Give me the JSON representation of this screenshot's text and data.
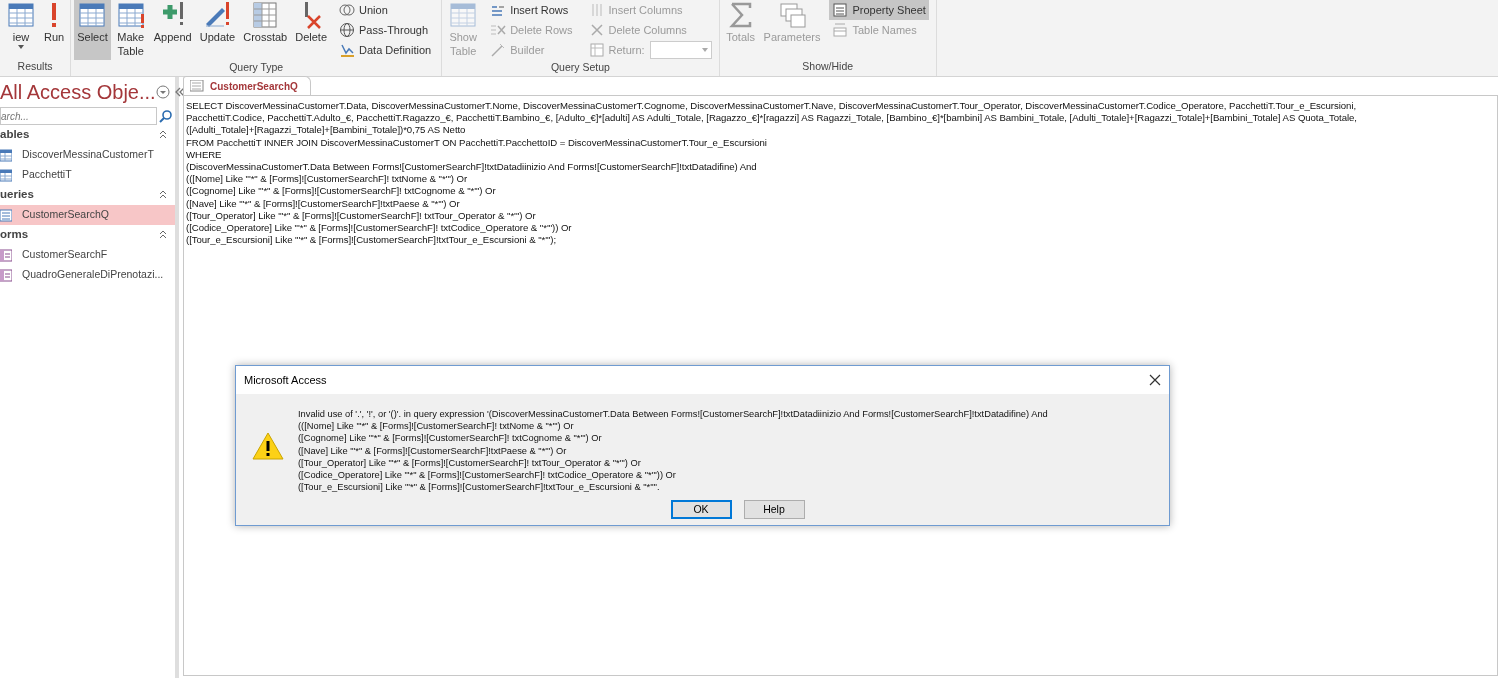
{
  "ribbon": {
    "groups": [
      {
        "label": "Results",
        "large": [
          {
            "label": "iew",
            "selected": false,
            "disabled": false,
            "dropdown": true
          },
          {
            "label": "Run",
            "selected": false,
            "disabled": false,
            "dropdown": false
          }
        ]
      },
      {
        "label": "Query Type",
        "large": [
          {
            "label": "Select",
            "selected": true,
            "disabled": false,
            "dropdown": false
          },
          {
            "label": "Make Table",
            "selected": false,
            "disabled": false,
            "dropdown": false
          },
          {
            "label": "Append",
            "selected": false,
            "disabled": false,
            "dropdown": false
          },
          {
            "label": "Update",
            "selected": false,
            "disabled": false,
            "dropdown": false
          },
          {
            "label": "Crosstab",
            "selected": false,
            "disabled": false,
            "dropdown": false
          },
          {
            "label": "Delete",
            "selected": false,
            "disabled": false,
            "dropdown": false
          }
        ],
        "small_columns": [
          [
            {
              "label": "Union",
              "kind": "button",
              "selected": false,
              "disabled": false
            },
            {
              "label": "Pass-Through",
              "kind": "button",
              "selected": false,
              "disabled": false
            },
            {
              "label": "Data Definition",
              "kind": "button",
              "selected": false,
              "disabled": false
            }
          ]
        ]
      },
      {
        "label": "Query Setup",
        "large": [
          {
            "label": "Show Table",
            "selected": false,
            "disabled": true,
            "dropdown": false
          }
        ],
        "small_columns": [
          [
            {
              "label": "Insert Rows",
              "kind": "button",
              "selected": false,
              "disabled": false
            },
            {
              "label": "Delete Rows",
              "kind": "button",
              "selected": false,
              "disabled": true
            },
            {
              "label": "Builder",
              "kind": "button",
              "selected": false,
              "disabled": true
            }
          ],
          [
            {
              "label": "Insert Columns",
              "kind": "button",
              "selected": false,
              "disabled": true
            },
            {
              "label": "Delete Columns",
              "kind": "button",
              "selected": false,
              "disabled": true
            },
            {
              "label": "Return:",
              "kind": "combo",
              "selected": false,
              "disabled": true
            }
          ]
        ]
      },
      {
        "label": "Show/Hide",
        "large": [
          {
            "label": "Totals",
            "selected": false,
            "disabled": true,
            "dropdown": false
          },
          {
            "label": "Parameters",
            "selected": false,
            "disabled": true,
            "dropdown": false
          }
        ],
        "small_columns": [
          [
            {
              "label": "Property Sheet",
              "kind": "button",
              "selected": true,
              "disabled": false
            },
            {
              "label": "Table Names",
              "kind": "button",
              "selected": false,
              "disabled": true
            }
          ]
        ]
      }
    ]
  },
  "nav": {
    "title": "All Access Obje...",
    "search": {
      "placeholder": "arch..."
    },
    "sections": [
      {
        "label": "ables",
        "kind": "table",
        "items": [
          {
            "label": "DiscoverMessinaCustomerT",
            "selected": false
          },
          {
            "label": "PacchettiT",
            "selected": false
          }
        ]
      },
      {
        "label": "ueries",
        "kind": "query",
        "items": [
          {
            "label": "CustomerSearchQ",
            "selected": true
          }
        ]
      },
      {
        "label": "orms",
        "kind": "form",
        "items": [
          {
            "label": "CustomerSearchF",
            "selected": false
          },
          {
            "label": "QuadroGeneraleDiPrenotazi...",
            "selected": false
          }
        ]
      }
    ]
  },
  "document": {
    "tab": "CustomerSearchQ",
    "sql_lines": [
      "SELECT DiscoverMessinaCustomerT.Data, DiscoverMessinaCustomerT.Nome, DiscoverMessinaCustomerT.Cognome, DiscoverMessinaCustomerT.Nave, DiscoverMessinaCustomerT.Tour_Operator, DiscoverMessinaCustomerT.Codice_Operatore, PacchettiT.Tour_e_Escursioni,",
      "PacchettiT.Codice, PacchettiT.Adulto_€, PacchettiT.Ragazzo_€, PacchettiT.Bambino_€, [Adulto_€]*[adulti] AS Adulti_Totale, [Ragazzo_€]*[ragazzi] AS Ragazzi_Totale, [Bambino_€]*[bambini] AS Bambini_Totale, [Adulti_Totale]+[Ragazzi_Totale]+[Bambini_Totale] AS Quota_Totale,",
      "([Adulti_Totale]+[Ragazzi_Totale]+[Bambini_Totale])*0,75 AS Netto",
      "FROM PacchettiT INNER JOIN DiscoverMessinaCustomerT ON PacchettiT.PacchettoID = DiscoverMessinaCustomerT.Tour_e_Escursioni",
      "WHERE",
      "(DiscoverMessinaCustomerT.Data Between Forms![CustomerSearchF]!txtDatadiinizio And Forms![CustomerSearchF]!txtDatadifine) And",
      "(([Nome] Like \"'*\" & [Forms]![CustomerSearchF]! txtNome & \"*'\") Or",
      "([Cognome] Like \"'*\" & [Forms]![CustomerSearchF]! txtCognome & \"*'\") Or",
      "([Nave] Like \"'*\" & [Forms]![CustomerSearchF]!txtPaese & \"*'\") Or",
      "([Tour_Operator] Like \"'*\" & [Forms]![CustomerSearchF]! txtTour_Operator & \"*'\") Or",
      "([Codice_Operatore] Like \"'*\" & [Forms]![CustomerSearchF]! txtCodice_Operatore & \"*'\")) Or",
      "([Tour_e_Escursioni] Like \"'*\" & [Forms]![CustomerSearchF]!txtTour_e_Escursioni & \"*'\");"
    ]
  },
  "dialog": {
    "title": "Microsoft Access",
    "message_lines": [
      "Invalid use of '.', '!', or '()'. in query expression '(DiscoverMessinaCustomerT.Data Between Forms![CustomerSearchF]!txtDatadiinizio And Forms![CustomerSearchF]!txtDatadifine) And",
      "(([Nome] Like \"'*\" & [Forms]![CustomerSearchF]! txtNome & \"*'\") Or",
      "([Cognome] Like \"'*\" & [Forms]![CustomerSearchF]! txtCognome & \"*'\") Or",
      "([Nave] Like \"'*\" & [Forms]![CustomerSearchF]!txtPaese & \"*'\") Or",
      "([Tour_Operator] Like \"'*\" & [Forms]![CustomerSearchF]! txtTour_Operator & \"*'\") Or",
      "([Codice_Operatore] Like \"'*\" & [Forms]![CustomerSearchF]! txtCodice_Operatore & \"*'\")) Or",
      "([Tour_e_Escursioni] Like \"'*\" & [Forms]![CustomerSearchF]!txtTour_e_Escursioni & \"*'\"'."
    ],
    "buttons": [
      {
        "label": "OK",
        "default": true
      },
      {
        "label": "Help",
        "default": false
      }
    ]
  }
}
